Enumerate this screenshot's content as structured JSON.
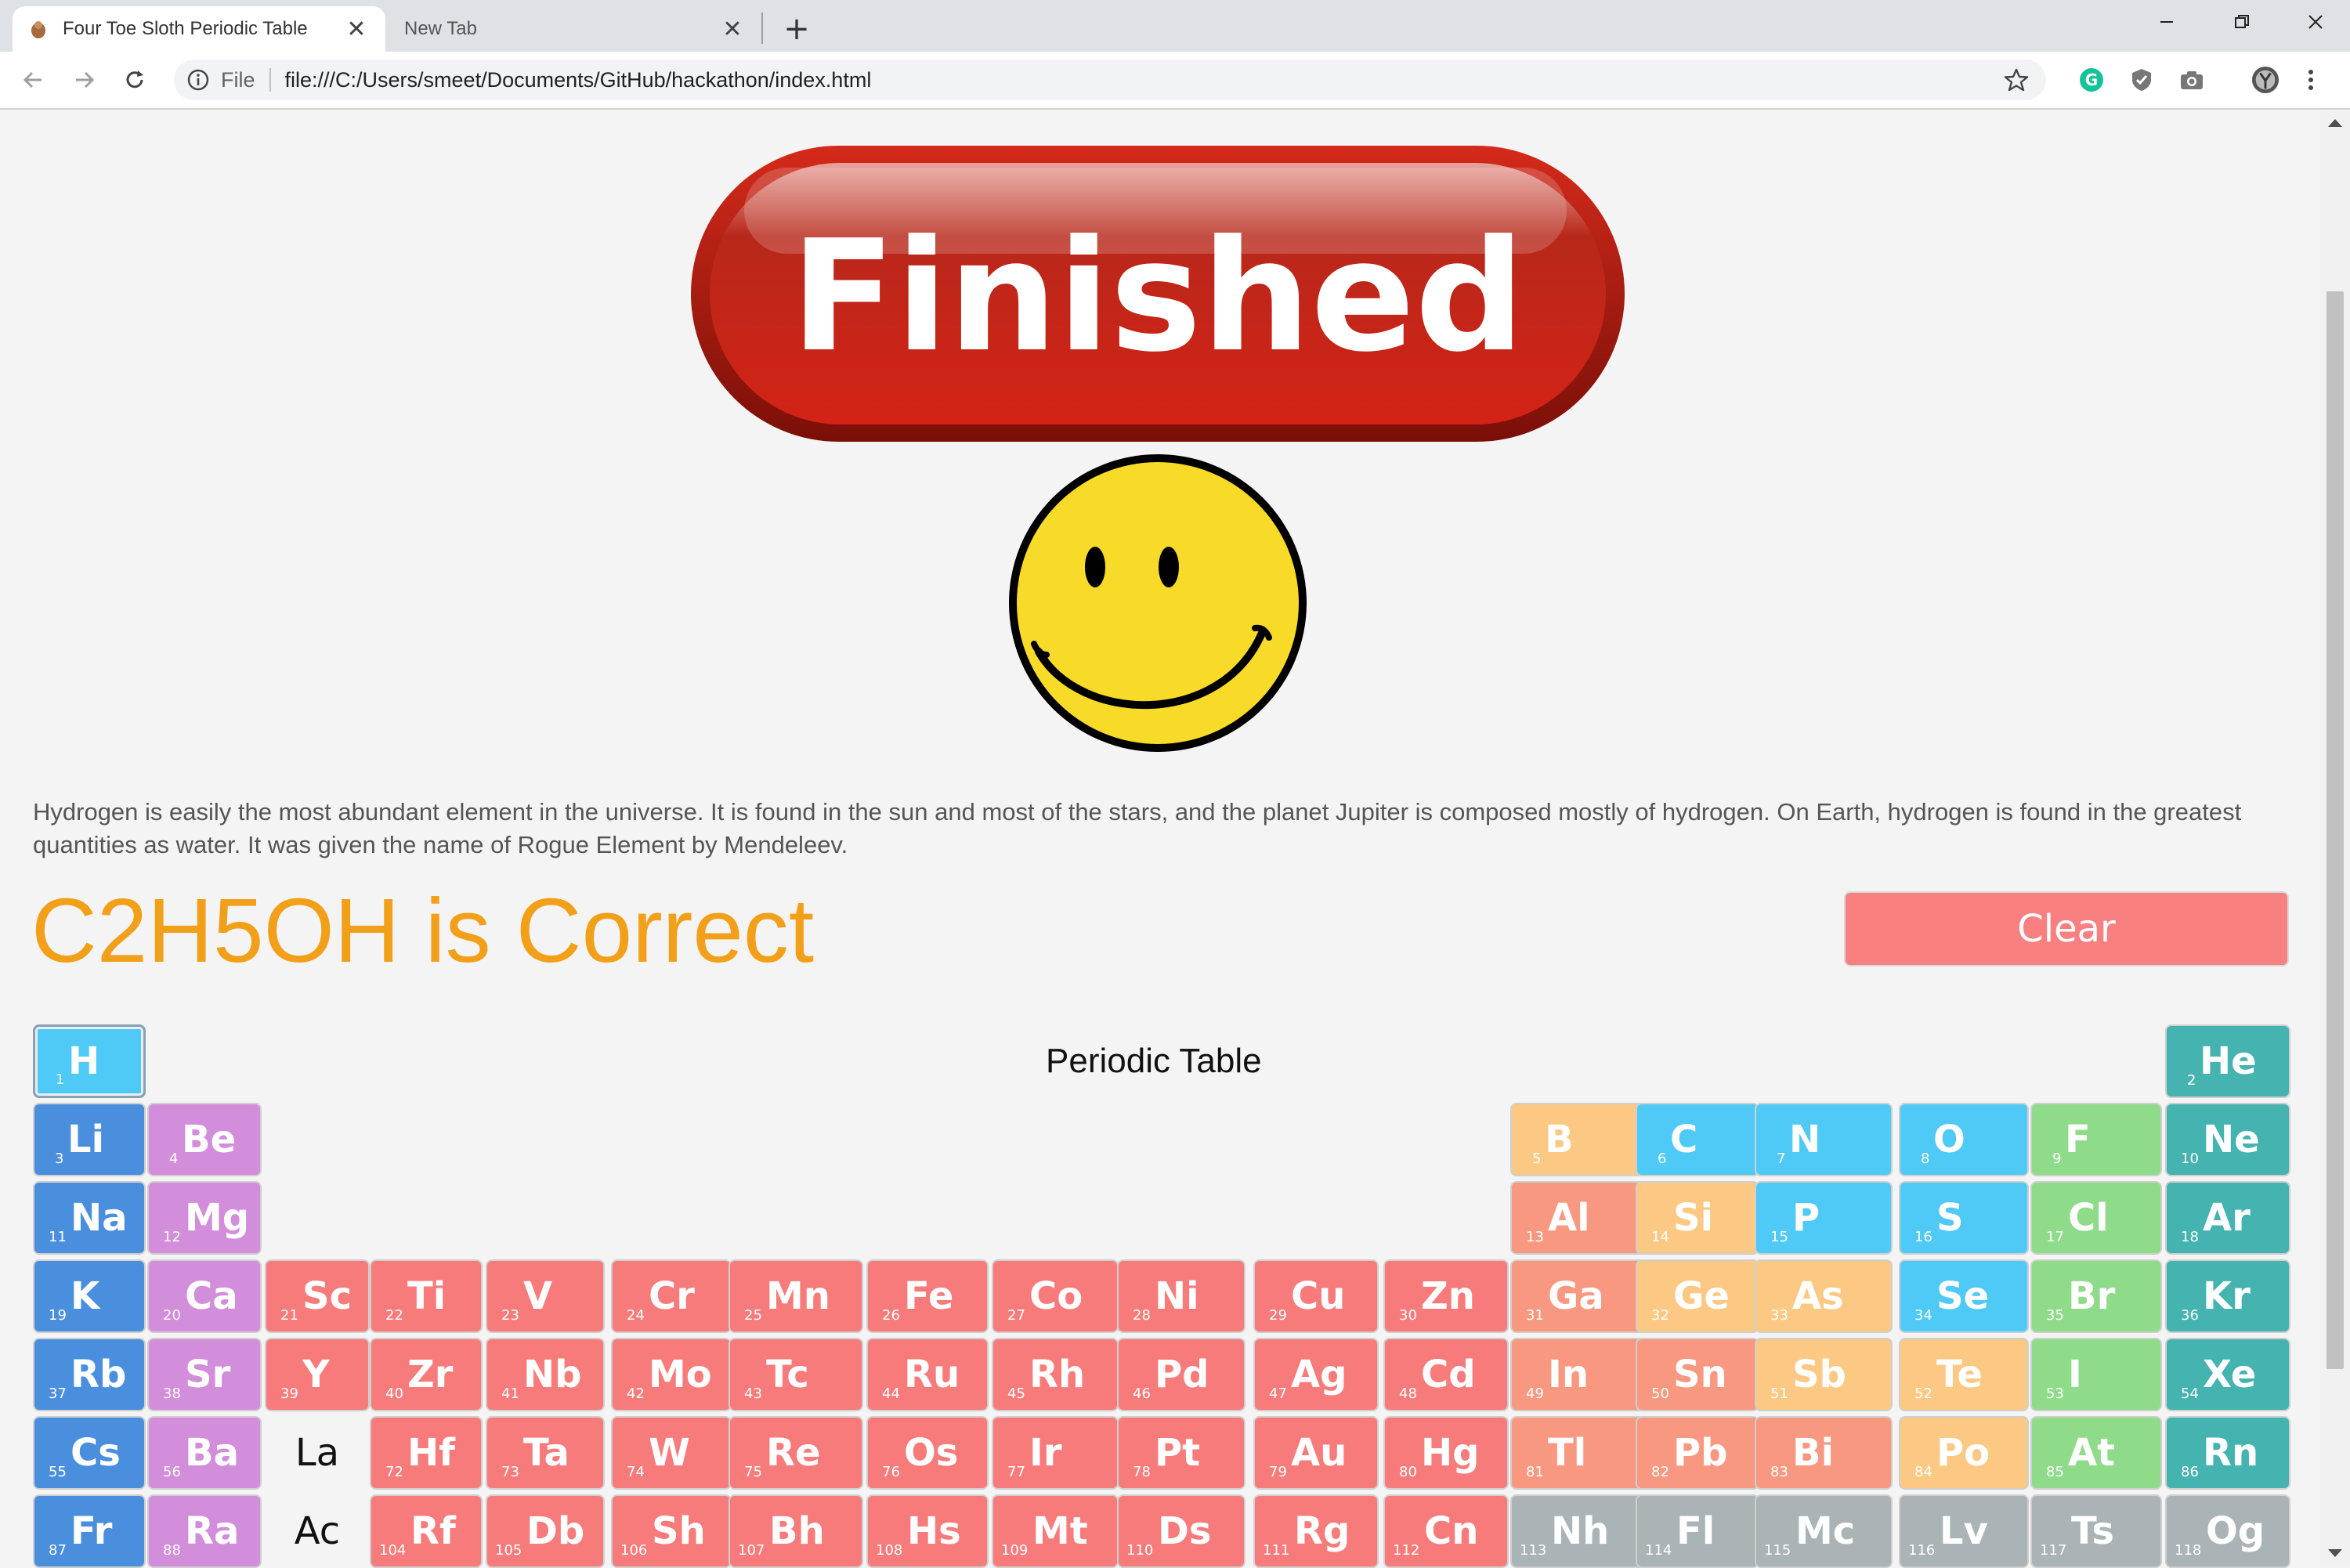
{
  "browser": {
    "tabs": [
      {
        "title": "Four Toe Sloth Periodic Table",
        "active": true,
        "favicon": "sloth-icon"
      },
      {
        "title": "New Tab",
        "active": false
      }
    ],
    "new_tab_label": "+",
    "omnibox": {
      "security_label": "File",
      "url": "file:///C:/Users/smeet/Documents/GitHub/hackathon/index.html"
    },
    "extensions": [
      "grammarly-icon",
      "shield-icon",
      "camera-icon",
      "profile-avatar"
    ]
  },
  "page": {
    "banner_text": "Finished",
    "description": "Hydrogen is easily the most abundant element in the universe. It is found in the sun and most of the stars, and the planet Jupiter is composed mostly of hydrogen. On Earth, hydrogen is found in the greatest quantities as water. It was given the name of Rogue Element by Mendeleev.",
    "result_text": "C2H5OH is Correct",
    "clear_label": "Clear",
    "table_caption": "Periodic Table",
    "lanthanide_placeholder": "La",
    "actinide_placeholder": "Ac",
    "colors": {
      "result": "#f2a01a",
      "alkali": "#4a8fde",
      "alkaline": "#d28ddb",
      "transition": "#f77b7b",
      "post_transition": "#f89880",
      "metalloid": "#fbc983",
      "nonmetal": "#4fcaf6",
      "halogen": "#8edc8a",
      "noble": "#45b3b0",
      "unknown": "#aab3b6"
    }
  },
  "elements": [
    {
      "n": 1,
      "s": "H",
      "c": "nonmetal",
      "selected": true
    },
    {
      "n": 2,
      "s": "He",
      "c": "noble"
    },
    {
      "n": 3,
      "s": "Li",
      "c": "alkali"
    },
    {
      "n": 4,
      "s": "Be",
      "c": "alkaline"
    },
    {
      "n": 5,
      "s": "B",
      "c": "metalloid"
    },
    {
      "n": 6,
      "s": "C",
      "c": "nonmetal"
    },
    {
      "n": 7,
      "s": "N",
      "c": "nonmetal"
    },
    {
      "n": 8,
      "s": "O",
      "c": "nonmetal"
    },
    {
      "n": 9,
      "s": "F",
      "c": "halogen"
    },
    {
      "n": 10,
      "s": "Ne",
      "c": "noble"
    },
    {
      "n": 11,
      "s": "Na",
      "c": "alkali"
    },
    {
      "n": 12,
      "s": "Mg",
      "c": "alkaline"
    },
    {
      "n": 13,
      "s": "Al",
      "c": "post_transition"
    },
    {
      "n": 14,
      "s": "Si",
      "c": "metalloid"
    },
    {
      "n": 15,
      "s": "P",
      "c": "nonmetal"
    },
    {
      "n": 16,
      "s": "S",
      "c": "nonmetal"
    },
    {
      "n": 17,
      "s": "Cl",
      "c": "halogen"
    },
    {
      "n": 18,
      "s": "Ar",
      "c": "noble"
    },
    {
      "n": 19,
      "s": "K",
      "c": "alkali"
    },
    {
      "n": 20,
      "s": "Ca",
      "c": "alkaline"
    },
    {
      "n": 21,
      "s": "Sc",
      "c": "transition"
    },
    {
      "n": 22,
      "s": "Ti",
      "c": "transition"
    },
    {
      "n": 23,
      "s": "V",
      "c": "transition"
    },
    {
      "n": 24,
      "s": "Cr",
      "c": "transition"
    },
    {
      "n": 25,
      "s": "Mn",
      "c": "transition"
    },
    {
      "n": 26,
      "s": "Fe",
      "c": "transition"
    },
    {
      "n": 27,
      "s": "Co",
      "c": "transition"
    },
    {
      "n": 28,
      "s": "Ni",
      "c": "transition"
    },
    {
      "n": 29,
      "s": "Cu",
      "c": "transition"
    },
    {
      "n": 30,
      "s": "Zn",
      "c": "transition"
    },
    {
      "n": 31,
      "s": "Ga",
      "c": "post_transition"
    },
    {
      "n": 32,
      "s": "Ge",
      "c": "metalloid"
    },
    {
      "n": 33,
      "s": "As",
      "c": "metalloid"
    },
    {
      "n": 34,
      "s": "Se",
      "c": "nonmetal"
    },
    {
      "n": 35,
      "s": "Br",
      "c": "halogen"
    },
    {
      "n": 36,
      "s": "Kr",
      "c": "noble"
    },
    {
      "n": 37,
      "s": "Rb",
      "c": "alkali"
    },
    {
      "n": 38,
      "s": "Sr",
      "c": "alkaline"
    },
    {
      "n": 39,
      "s": "Y",
      "c": "transition"
    },
    {
      "n": 40,
      "s": "Zr",
      "c": "transition"
    },
    {
      "n": 41,
      "s": "Nb",
      "c": "transition"
    },
    {
      "n": 42,
      "s": "Mo",
      "c": "transition"
    },
    {
      "n": 43,
      "s": "Tc",
      "c": "transition"
    },
    {
      "n": 44,
      "s": "Ru",
      "c": "transition"
    },
    {
      "n": 45,
      "s": "Rh",
      "c": "transition"
    },
    {
      "n": 46,
      "s": "Pd",
      "c": "transition"
    },
    {
      "n": 47,
      "s": "Ag",
      "c": "transition"
    },
    {
      "n": 48,
      "s": "Cd",
      "c": "transition"
    },
    {
      "n": 49,
      "s": "In",
      "c": "post_transition"
    },
    {
      "n": 50,
      "s": "Sn",
      "c": "post_transition"
    },
    {
      "n": 51,
      "s": "Sb",
      "c": "metalloid"
    },
    {
      "n": 52,
      "s": "Te",
      "c": "metalloid"
    },
    {
      "n": 53,
      "s": "I",
      "c": "halogen"
    },
    {
      "n": 54,
      "s": "Xe",
      "c": "noble"
    },
    {
      "n": 55,
      "s": "Cs",
      "c": "alkali"
    },
    {
      "n": 56,
      "s": "Ba",
      "c": "alkaline"
    },
    {
      "n": 72,
      "s": "Hf",
      "c": "transition"
    },
    {
      "n": 73,
      "s": "Ta",
      "c": "transition"
    },
    {
      "n": 74,
      "s": "W",
      "c": "transition"
    },
    {
      "n": 75,
      "s": "Re",
      "c": "transition"
    },
    {
      "n": 76,
      "s": "Os",
      "c": "transition"
    },
    {
      "n": 77,
      "s": "Ir",
      "c": "transition"
    },
    {
      "n": 78,
      "s": "Pt",
      "c": "transition"
    },
    {
      "n": 79,
      "s": "Au",
      "c": "transition"
    },
    {
      "n": 80,
      "s": "Hg",
      "c": "transition"
    },
    {
      "n": 81,
      "s": "Tl",
      "c": "post_transition"
    },
    {
      "n": 82,
      "s": "Pb",
      "c": "post_transition"
    },
    {
      "n": 83,
      "s": "Bi",
      "c": "post_transition"
    },
    {
      "n": 84,
      "s": "Po",
      "c": "metalloid"
    },
    {
      "n": 85,
      "s": "At",
      "c": "halogen"
    },
    {
      "n": 86,
      "s": "Rn",
      "c": "noble"
    },
    {
      "n": 87,
      "s": "Fr",
      "c": "alkali"
    },
    {
      "n": 88,
      "s": "Ra",
      "c": "alkaline"
    },
    {
      "n": 104,
      "s": "Rf",
      "c": "transition"
    },
    {
      "n": 105,
      "s": "Db",
      "c": "transition"
    },
    {
      "n": 106,
      "s": "Sh",
      "c": "transition"
    },
    {
      "n": 107,
      "s": "Bh",
      "c": "transition"
    },
    {
      "n": 108,
      "s": "Hs",
      "c": "transition"
    },
    {
      "n": 109,
      "s": "Mt",
      "c": "transition"
    },
    {
      "n": 110,
      "s": "Ds",
      "c": "transition"
    },
    {
      "n": 111,
      "s": "Rg",
      "c": "transition"
    },
    {
      "n": 112,
      "s": "Cn",
      "c": "transition"
    },
    {
      "n": 113,
      "s": "Nh",
      "c": "unknown"
    },
    {
      "n": 114,
      "s": "Fl",
      "c": "unknown"
    },
    {
      "n": 115,
      "s": "Mc",
      "c": "unknown"
    },
    {
      "n": 116,
      "s": "Lv",
      "c": "unknown"
    },
    {
      "n": 117,
      "s": "Ts",
      "c": "unknown"
    },
    {
      "n": 118,
      "s": "Og",
      "c": "unknown"
    }
  ]
}
